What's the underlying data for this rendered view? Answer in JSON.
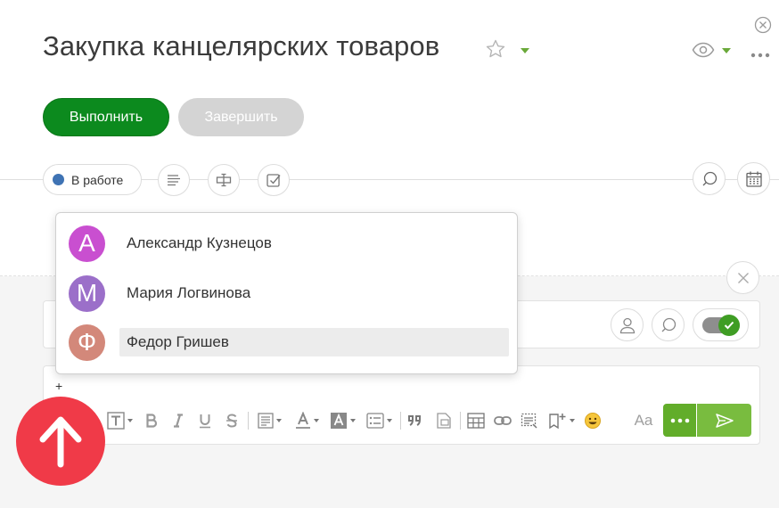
{
  "header": {
    "title": "Закупка канцелярских товаров"
  },
  "actions": {
    "primary_label": "Выполнить",
    "secondary_label": "Завершить"
  },
  "status": {
    "label": "В работе",
    "color": "#3f73b4"
  },
  "dropdown": {
    "people": [
      {
        "initial": "А",
        "name": "Александр Кузнецов",
        "color": "#c94fd0"
      },
      {
        "initial": "М",
        "name": "Мария Логвинова",
        "color": "#9b6fc9"
      },
      {
        "initial": "Ф",
        "name": "Федор Гришев",
        "color": "#d3887a",
        "selected": true
      }
    ]
  },
  "editor": {
    "plus": "+",
    "font_size_label": "Aa"
  },
  "colors": {
    "primary": "#0c8a1e",
    "send": "#79bc3f",
    "toggle_on": "#3f9d24",
    "scroll_up": "#f03a48"
  }
}
